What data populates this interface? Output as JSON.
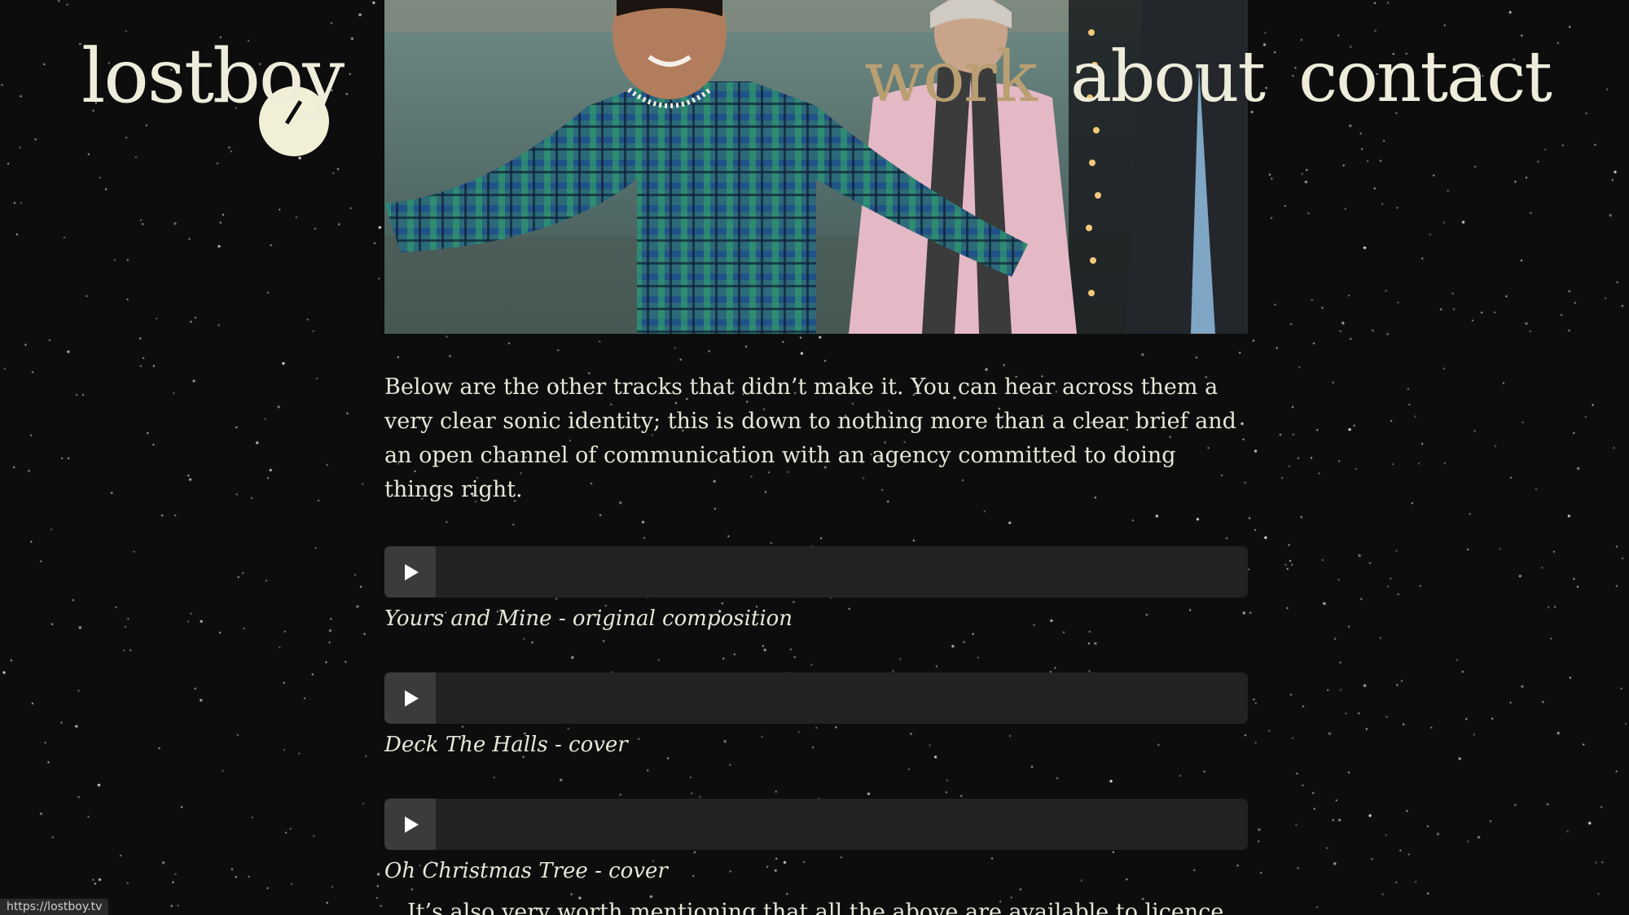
{
  "brand": {
    "name": "lostboy"
  },
  "nav": {
    "items": [
      {
        "label": "work",
        "active": true
      },
      {
        "label": "about",
        "active": false
      },
      {
        "label": "contact",
        "active": false
      }
    ]
  },
  "intro": "Below are the other tracks that didn’t make it. You can hear across them a very clear sonic identity; this is down to nothing more than a clear brief and an open channel of communication with an agency committed to doing things right.",
  "tracks": [
    {
      "title": "Yours and Mine - original composition"
    },
    {
      "title": "Deck The Halls - cover"
    },
    {
      "title": "Oh Christmas Tree - cover"
    }
  ],
  "more_text": "It’s also very worth mentioning that all the above are available to licence",
  "status_bar": {
    "url": "https://lostboy.tv"
  },
  "colors": {
    "background": "#0d0d0d",
    "text": "#eeeddb",
    "active_nav": "#b99f72",
    "player_bg": "#222222",
    "play_button_bg": "#3b3b3b"
  },
  "icons": {
    "play": "play-icon"
  }
}
